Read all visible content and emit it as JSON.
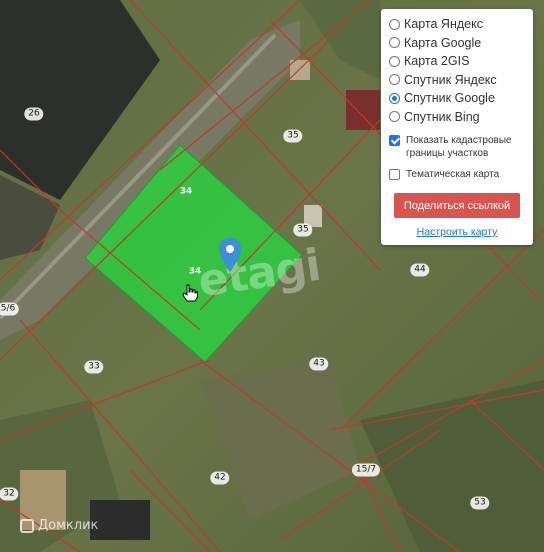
{
  "map": {
    "plot_labels": [
      {
        "id": "26",
        "text": "26"
      },
      {
        "id": "35a",
        "text": "35"
      },
      {
        "id": "34a",
        "text": "34"
      },
      {
        "id": "35b",
        "text": "35"
      },
      {
        "id": "34b",
        "text": "34"
      },
      {
        "id": "44",
        "text": "44"
      },
      {
        "id": "56",
        "text": "5/6"
      },
      {
        "id": "33",
        "text": "33"
      },
      {
        "id": "43",
        "text": "43"
      },
      {
        "id": "42",
        "text": "42"
      },
      {
        "id": "157",
        "text": "15/7"
      },
      {
        "id": "32",
        "text": "32"
      },
      {
        "id": "53",
        "text": "53"
      }
    ],
    "selected_plot_color": "#2ecc40",
    "boundary_color": "#c0392b",
    "watermark": "etagi",
    "domclick_brand": "Домклик"
  },
  "panel": {
    "map_types": [
      {
        "label": "Карта Яндекс",
        "selected": false
      },
      {
        "label": "Карта Google",
        "selected": false
      },
      {
        "label": "Карта 2GIS",
        "selected": false
      },
      {
        "label": "Спутник Яндекс",
        "selected": false
      },
      {
        "label": "Спутник Google",
        "selected": true
      },
      {
        "label": "Спутник Bing",
        "selected": false
      }
    ],
    "cadastral_label": "Показать кадастровые границы участков",
    "cadastral_checked": true,
    "thematic_label": "Тематическая карта",
    "thematic_checked": false,
    "share_button": "Поделиться ссылкой",
    "configure_link": "Настроить карту",
    "accent_color": "#1a73e8",
    "share_color": "#d9534f"
  }
}
